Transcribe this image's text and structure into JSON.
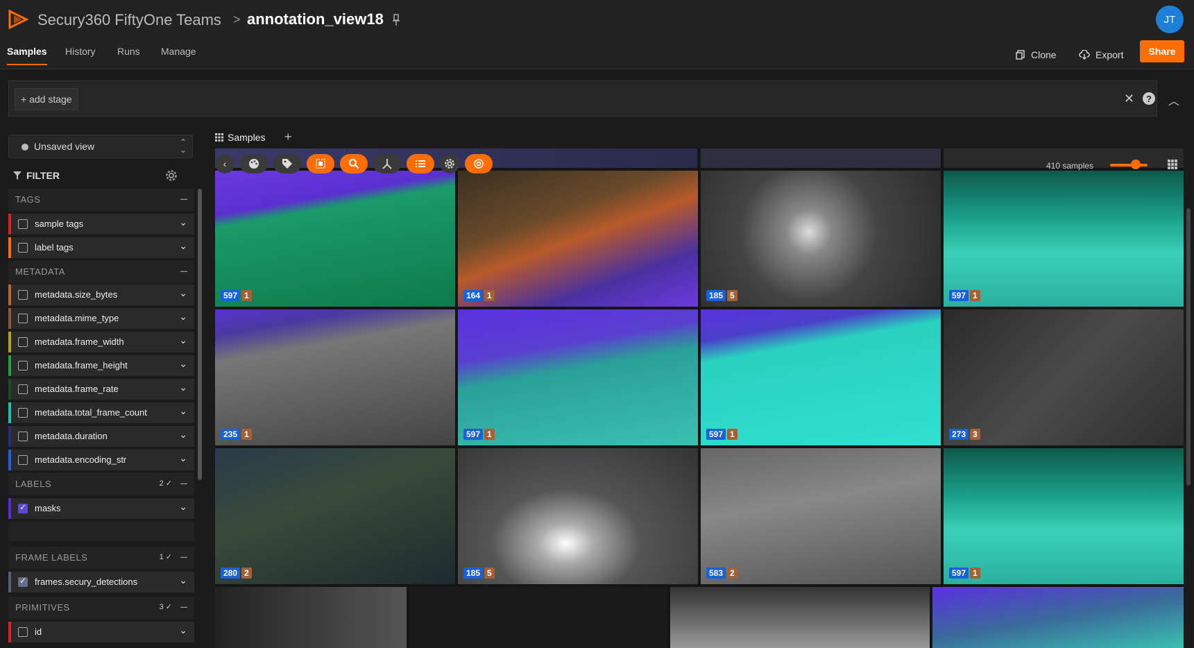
{
  "header": {
    "org": "Secury360 FiftyOne Teams",
    "separator": ">",
    "dataset": "annotation_view18",
    "avatar": "JT"
  },
  "nav": {
    "tabs": [
      {
        "label": "Samples"
      },
      {
        "label": "History"
      },
      {
        "label": "Runs"
      },
      {
        "label": "Manage"
      }
    ],
    "clone_label": "Clone",
    "export_label": "Export",
    "share_label": "Share"
  },
  "stagebar": {
    "add_stage_label": "+ add stage",
    "help": "?"
  },
  "sidebar": {
    "view_selector": "Unsaved view",
    "filter_label": "FILTER",
    "sections": {
      "tags": "TAGS",
      "metadata": "METADATA",
      "labels": "LABELS",
      "labels_count": "2",
      "frame_labels": "FRAME LABELS",
      "frame_labels_count": "1",
      "primitives": "PRIMITIVES",
      "primitives_count": "3"
    },
    "fields": {
      "sample_tags": "sample tags",
      "label_tags": "label tags",
      "size_bytes": "metadata.size_bytes",
      "mime_type": "metadata.mime_type",
      "frame_width": "metadata.frame_width",
      "frame_height": "metadata.frame_height",
      "frame_rate": "metadata.frame_rate",
      "total_frame_count": "metadata.total_frame_count",
      "duration": "metadata.duration",
      "encoding_str": "metadata.encoding_str",
      "masks": "masks",
      "frames_detections": "frames.secury_detections",
      "id": "id"
    }
  },
  "tabs": {
    "samples_label": "Samples"
  },
  "grid": {
    "sample_count": "410 samples",
    "tiles": [
      {
        "a": "597",
        "b": "1"
      },
      {
        "a": "164",
        "b": "1"
      },
      {
        "a": "185",
        "b": "5"
      },
      {
        "a": "597",
        "b": "1"
      },
      {
        "a": "235",
        "b": "1"
      },
      {
        "a": "597",
        "b": "1"
      },
      {
        "a": "597",
        "b": "1"
      },
      {
        "a": "273",
        "b": "3"
      },
      {
        "a": "280",
        "b": "2"
      },
      {
        "a": "185",
        "b": "5"
      },
      {
        "a": "583",
        "b": "2"
      },
      {
        "a": "597",
        "b": "1"
      }
    ]
  },
  "colors": {
    "accent": "#ff6d04",
    "badge_blue": "#1862d8",
    "badge_brown": "#a0623a"
  }
}
